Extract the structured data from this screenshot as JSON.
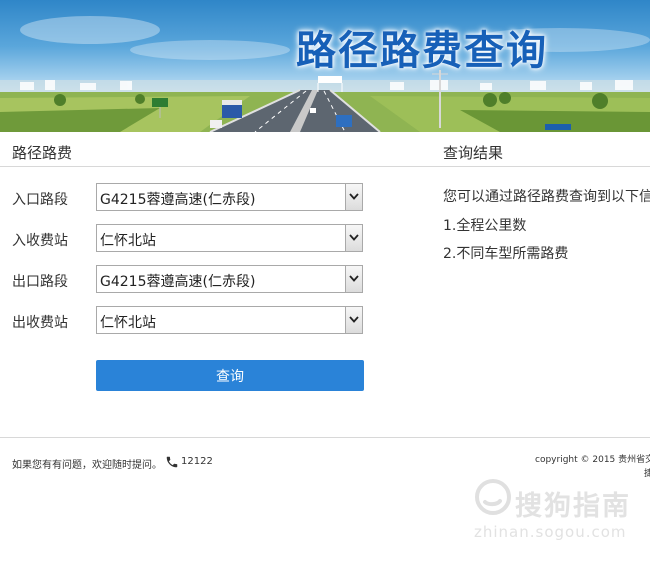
{
  "banner": {
    "title": "路径路费查询"
  },
  "form": {
    "heading": "路径路费",
    "entry_road": {
      "label": "入口路段",
      "value": "G4215蓉遵高速(仁赤段)"
    },
    "entry_station": {
      "label": "入收费站",
      "value": "仁怀北站"
    },
    "exit_road": {
      "label": "出口路段",
      "value": "G4215蓉遵高速(仁赤段)"
    },
    "exit_station": {
      "label": "出收费站",
      "value": "仁怀北站"
    },
    "query_label": "查询"
  },
  "results": {
    "heading": "查询结果",
    "intro": "您可以通过路径路费查询到以下信",
    "items": [
      "1.全程公里数",
      "2.不同车型所需路费"
    ]
  },
  "footer": {
    "help_text": "如果您有有问题，欢迎随时提问。",
    "phone": "12122",
    "copyright": "copyright © 2015 贵州省交",
    "copyright_line2": "捷"
  },
  "watermark": {
    "text": "搜狗指南",
    "sub": "zhinan.sogou.com"
  },
  "colors": {
    "accent": "#2a83d8",
    "title": "#1760b8"
  }
}
